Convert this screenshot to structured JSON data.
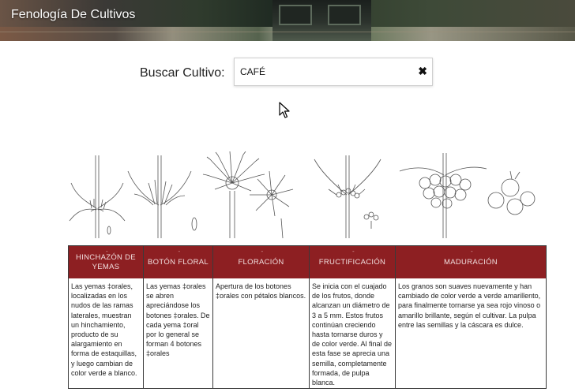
{
  "header": {
    "title": "Fenología De Cultivos"
  },
  "search": {
    "label": "Buscar Cultivo:",
    "value": "CAFÉ",
    "clear_glyph": "✖"
  },
  "stages": [
    {
      "title": "HINCHAZÓN DE YEMAS",
      "text": "Las yemas ‡orales, localizadas en los nudos de las ramas laterales, muestran un hinchamiento, producto de su alargamiento en forma de estaquillas, y luego cambian de color verde a blanco."
    },
    {
      "title": "BOTÓN FLORAL",
      "text": "Las yemas ‡orales se abren apreciándose los botones ‡orales. De cada yema ‡oral por lo general se forman 4 botones ‡orales"
    },
    {
      "title": "FLORACIÓN",
      "text": "Apertura de los botones ‡orales con pétalos blancos."
    },
    {
      "title": "FRUCTIFICACIÓN",
      "text": "Se inicia con el cuajado de los frutos, donde alcanzan un diámetro de 3 a 5 mm. Estos frutos continúan creciendo hasta tornarse duros y de color verde. Al final de esta fase se aprecia una semilla, completamente formada, de pulpa blanca."
    },
    {
      "title": "MADURACIÓN",
      "text": "Los granos son suaves nuevamente y han cambiado de color verde a verde amarillento, para finalmente tornarse ya sea rojo vinoso o amarillo brillante, según el cultivar. La pulpa entre las semillas y la cáscara es dulce."
    }
  ],
  "icons": {
    "clear": "close-x-icon",
    "cursor": "mouse-pointer-icon"
  },
  "colors": {
    "stage_header": "#8d1f22",
    "stage_header_text": "#f1dede"
  }
}
